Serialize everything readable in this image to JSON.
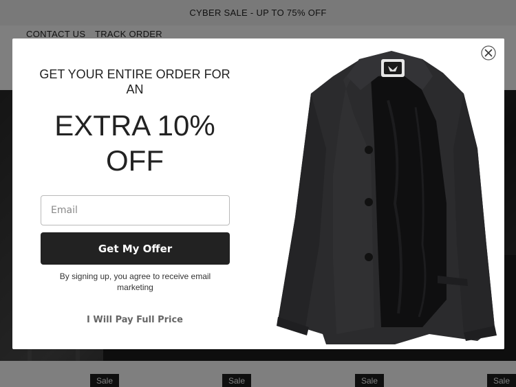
{
  "announcement": {
    "text": "CYBER SALE - UP TO 75% OFF"
  },
  "nav": {
    "contact": "CONTACT US",
    "track": "TRACK ORDER"
  },
  "products": {
    "badges": [
      "Sale",
      "Sale",
      "Sale",
      "Sale"
    ]
  },
  "popup": {
    "headline_small": "GET YOUR ENTIRE ORDER FOR AN",
    "headline_big": "EXTRA 10% OFF",
    "email_placeholder": "Email",
    "submit_label": "Get My Offer",
    "consent": "By signing up, you agree to receive email marketing",
    "decline_label": "I Will Pay Full Price",
    "close_icon": "close-icon",
    "image_icon": "jacket-image"
  },
  "colors": {
    "button_bg": "#222222",
    "overlay": "rgba(0,0,0,0.5)",
    "announcement_bg": "#f2f2f2"
  }
}
